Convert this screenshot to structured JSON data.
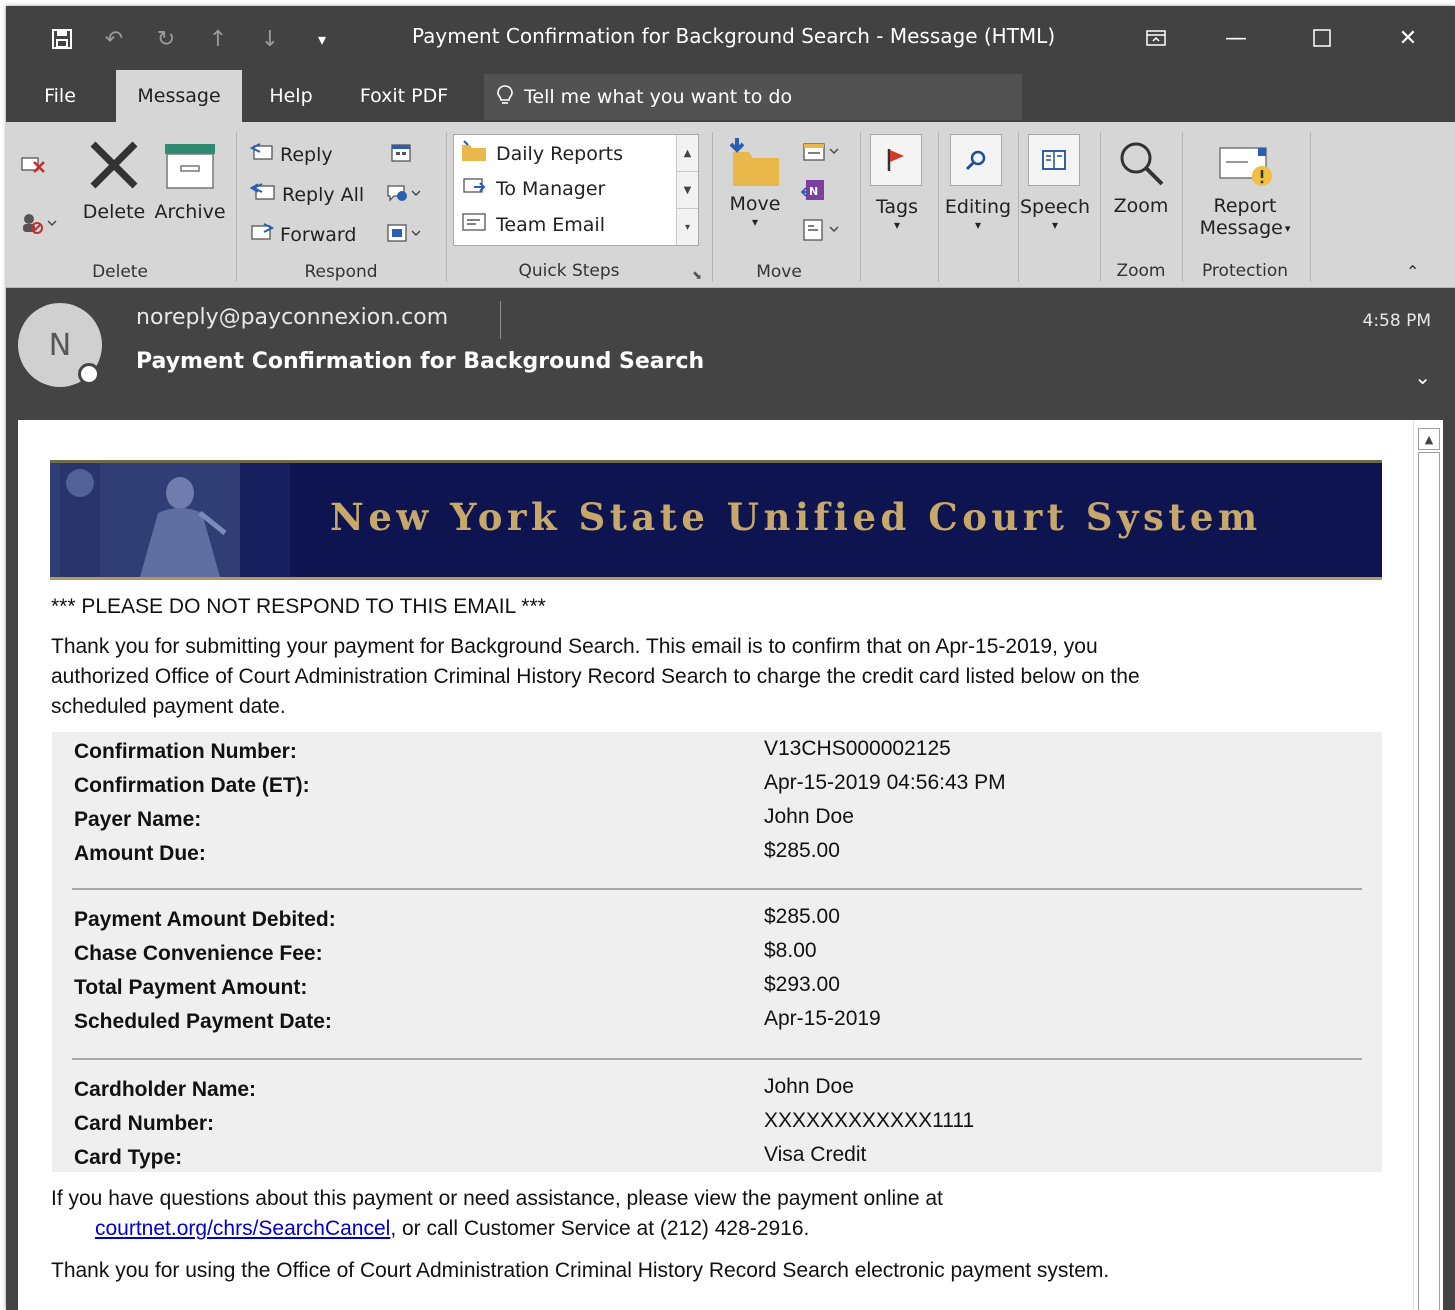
{
  "window": {
    "title": "Payment Confirmation for Background Search  -  Message (HTML)"
  },
  "tabs": {
    "file": "File",
    "message": "Message",
    "help": "Help",
    "foxit": "Foxit PDF",
    "tell_me": "Tell me what you want to do"
  },
  "ribbon": {
    "delete_group": {
      "delete": "Delete",
      "archive": "Archive",
      "label": "Delete"
    },
    "respond_group": {
      "reply": "Reply",
      "reply_all": "Reply All",
      "forward": "Forward",
      "label": "Respond"
    },
    "quick_steps": {
      "items": [
        "Daily Reports",
        "To Manager",
        "Team Email"
      ],
      "label": "Quick Steps"
    },
    "move_group": {
      "move": "Move",
      "label": "Move"
    },
    "tags": "Tags",
    "editing": "Editing",
    "speech": "Speech",
    "zoom": "Zoom",
    "zoom_label": "Zoom",
    "report_line1": "Report",
    "report_line2": "Message",
    "protection_label": "Protection"
  },
  "message": {
    "avatar_initial": "N",
    "sender": "noreply@payconnexion.com",
    "subject": "Payment Confirmation for Background Search",
    "time": "4:58 PM"
  },
  "email_body": {
    "banner_title": "New York State Unified Court System",
    "notice": "*** PLEASE DO NOT RESPOND TO THIS EMAIL ***",
    "intro_line1": "Thank you for submitting your payment for Background Search. This email is to confirm that on Apr-15-2019, you",
    "intro_line2": "authorized Office of Court Administration Criminal History Record Search to charge the credit card listed below on the",
    "intro_line3": "scheduled payment date.",
    "section1": [
      {
        "label": "Confirmation Number:",
        "value": "V13CHS000002125"
      },
      {
        "label": "Confirmation Date (ET):",
        "value": "Apr-15-2019 04:56:43 PM"
      },
      {
        "label": "Payer Name:",
        "value": "John Doe"
      },
      {
        "label": "Amount Due:",
        "value": "$285.00"
      }
    ],
    "section2": [
      {
        "label": "Payment Amount Debited:",
        "value": "$285.00"
      },
      {
        "label": "Chase Convenience Fee:",
        "value": "$8.00"
      },
      {
        "label": "Total Payment Amount:",
        "value": "$293.00"
      },
      {
        "label": "Scheduled Payment Date:",
        "value": "Apr-15-2019"
      }
    ],
    "section3": [
      {
        "label": "Cardholder Name:",
        "value": "John Doe"
      },
      {
        "label": "Card Number:",
        "value": "XXXXXXXXXXXX1111"
      },
      {
        "label": "Card Type:",
        "value": "Visa Credit"
      }
    ],
    "questions_line1": "If you have questions about this payment or need assistance, please view the payment online at",
    "link_text": "courtnet.org/chrs/SearchCancel",
    "questions_line2_suffix": ", or call Customer Service at (212) 428-2916.",
    "closing": "Thank you for using the Office of Court Administration Criminal History Record Search electronic payment system."
  }
}
